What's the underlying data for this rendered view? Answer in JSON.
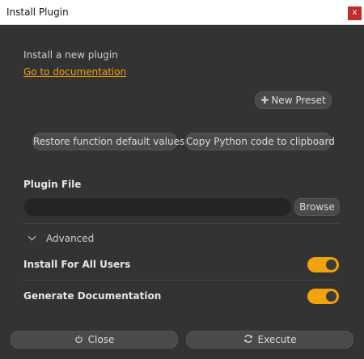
{
  "window": {
    "title": "Install Plugin",
    "close_glyph": "x"
  },
  "intro": {
    "text": "Install a new plugin",
    "doc_link": "Go to documentation"
  },
  "toolbar": {
    "new_preset_label": "New Preset",
    "new_preset_icon": "plus-icon",
    "restore_label": "Restore function default values",
    "copy_python_label": "Copy Python code to clipboard"
  },
  "plugin_file": {
    "label": "Plugin File",
    "value": "",
    "placeholder": "",
    "browse_label": "Browse"
  },
  "advanced": {
    "label": "Advanced",
    "expanded": true
  },
  "options": [
    {
      "label": "Install For All Users",
      "enabled": true
    },
    {
      "label": "Generate Documentation",
      "enabled": true
    }
  ],
  "footer": {
    "close_label": "Close",
    "close_icon": "power-icon",
    "execute_label": "Execute",
    "execute_icon": "refresh-icon"
  },
  "colors": {
    "accent": "#f0a30a",
    "background": "#333333",
    "button": "#4a4a4a",
    "input": "#242424",
    "close_red": "#c42b2b"
  }
}
